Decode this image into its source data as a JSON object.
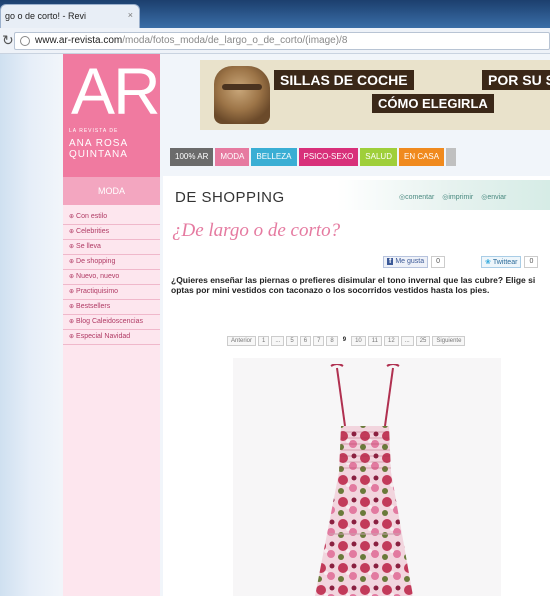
{
  "browser": {
    "tab_title": "go o de corto! - Revi",
    "tab_close": "×",
    "url_domain": "www.ar-revista.com",
    "url_path": "/moda/fotos_moda/de_largo_o_de_corto/(image)/8"
  },
  "sidebar": {
    "logo_text": "AR",
    "logo_sub": "LA REVISTA DE",
    "logo_name": "ANA ROSA QUINTANA",
    "section": "MODA",
    "items": [
      {
        "label": "Con estilo"
      },
      {
        "label": "Celebrities"
      },
      {
        "label": "Se lleva"
      },
      {
        "label": "De shopping"
      },
      {
        "label": "Nuevo, nuevo"
      },
      {
        "label": "Practiquisimo"
      },
      {
        "label": "Bestsellers"
      },
      {
        "label": "Blog Caleidoscencias"
      },
      {
        "label": "Especial Navidad"
      }
    ]
  },
  "banner": {
    "line1": "SILLAS DE COCHE",
    "line2": "POR SU S",
    "line3": "CÓMO ELEGIRLA"
  },
  "nav": {
    "items": [
      {
        "label": "100% AR",
        "color": "#6b6b6b"
      },
      {
        "label": "MODA",
        "color": "#e67aa0"
      },
      {
        "label": "BELLEZA",
        "color": "#3aaed4"
      },
      {
        "label": "PSICO-SEXO",
        "color": "#d8307a"
      },
      {
        "label": "SALUD",
        "color": "#9fcf3a"
      },
      {
        "label": "EN CASA",
        "color": "#f08a1e"
      },
      {
        "label": "",
        "color": "#c0c0c0"
      }
    ]
  },
  "article": {
    "section_title": "DE SHOPPING",
    "actions": [
      "comentar",
      "imprimir",
      "enviar"
    ],
    "title": "¿De largo o de corto?",
    "like_label": "Me gusta",
    "like_count": "0",
    "tweet_label": "Twittear",
    "tweet_count": "0",
    "intro": "¿Quieres enseñar las piernas o prefieres disimular el tono invernal que las cubre? Elige si optas por mini vestidos con taconazo o los socorridos vestidos hasta los pies.",
    "pager": {
      "prev": "Anterior",
      "pages": [
        "1",
        "...",
        "5",
        "6",
        "7",
        "8",
        "9",
        "10",
        "11",
        "12",
        "...",
        "25"
      ],
      "current": "9",
      "next": "Siguiente"
    }
  }
}
